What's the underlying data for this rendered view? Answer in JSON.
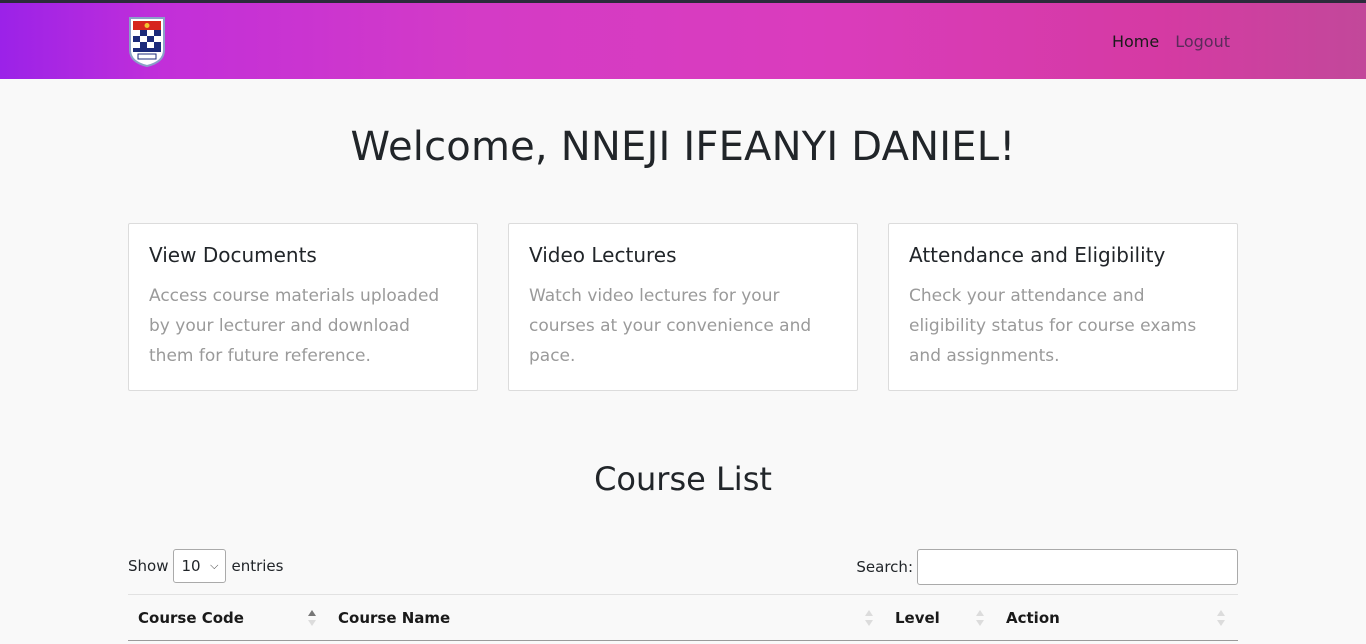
{
  "nav": {
    "home": "Home",
    "logout": "Logout"
  },
  "welcome": "Welcome, NNEJI IFEANYI DANIEL!",
  "cards": [
    {
      "title": "View Documents",
      "text": "Access course materials uploaded by your lecturer and download them for future reference."
    },
    {
      "title": "Video Lectures",
      "text": "Watch video lectures for your courses at your convenience and pace."
    },
    {
      "title": "Attendance and Eligibility",
      "text": "Check your attendance and eligibility status for course exams and assignments."
    }
  ],
  "course_list": {
    "heading": "Course List",
    "show_label": "Show",
    "entries_value": "10",
    "entries_label": "entries",
    "search_label": "Search:",
    "columns": [
      "Course Code",
      "Course Name",
      "Level",
      "Action"
    ]
  },
  "icons": {
    "logo": "university-crest-icon",
    "select": "chevron-down-icon",
    "sort": "sort-arrows-icon"
  },
  "colors": {
    "nav_gradient_start": "#9b22e8",
    "nav_gradient_mid": "#da3cbd",
    "nav_gradient_end": "#c2489a",
    "card_text": "#9a9a9a"
  }
}
